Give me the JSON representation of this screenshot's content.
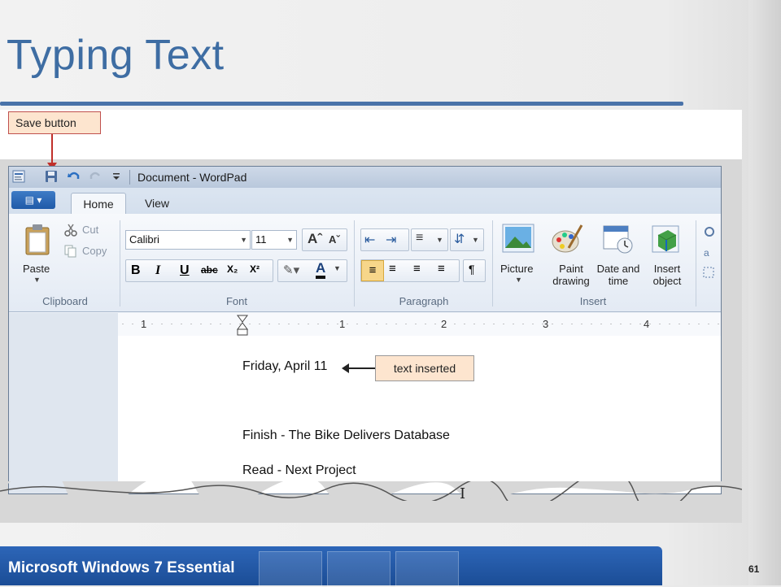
{
  "slide": {
    "title": "Typing Text",
    "footer_text": "Microsoft Windows 7 Essential",
    "page_number": "61"
  },
  "callouts": {
    "save_button": "Save button",
    "text_inserted": "text inserted"
  },
  "window": {
    "title": "Document - WordPad",
    "tabs": [
      "Home",
      "View"
    ],
    "clipboard": {
      "paste": "Paste",
      "cut": "Cut",
      "copy": "Copy",
      "group": "Clipboard"
    },
    "font": {
      "family": "Calibri",
      "size": "11",
      "group": "Font",
      "buttons": [
        "B",
        "I",
        "U",
        "abc",
        "X₂",
        "X²"
      ]
    },
    "paragraph": {
      "group": "Paragraph"
    },
    "insert": {
      "picture": "Picture",
      "paint_drawing_1": "Paint",
      "paint_drawing_2": "drawing",
      "date_time_1": "Date and",
      "date_time_2": "time",
      "insert_object_1": "Insert",
      "insert_object_2": "object",
      "group": "Insert"
    },
    "ruler_numbers": [
      "1",
      "1",
      "2",
      "3",
      "4"
    ]
  },
  "document": {
    "lines": [
      "Friday, April 11",
      "Finish - The Bike Delivers Database",
      "Read - Next Project"
    ]
  },
  "colors": {
    "title": "#3e6da3",
    "accent": "#4a73a9",
    "footer": "#2d66b8",
    "callout_fill": "#fde5cf",
    "callout_border": "#c0504d"
  }
}
